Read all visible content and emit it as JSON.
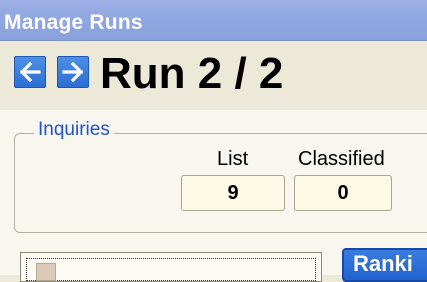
{
  "window": {
    "title": "Manage Runs"
  },
  "nav": {
    "prev_icon": "arrow-left-icon",
    "next_icon": "arrow-right-icon",
    "run_title": "Run 2 / 2"
  },
  "inquiries": {
    "legend": "Inquiries",
    "list_label": "List",
    "list_value": "9",
    "classified_label": "Classified",
    "classified_value": "0"
  },
  "ranking_button": {
    "label": "Ranki"
  },
  "colors": {
    "titlebar": "#8ea5e0",
    "accent_blue": "#2c6fd3",
    "legend_text": "#2353c8"
  }
}
